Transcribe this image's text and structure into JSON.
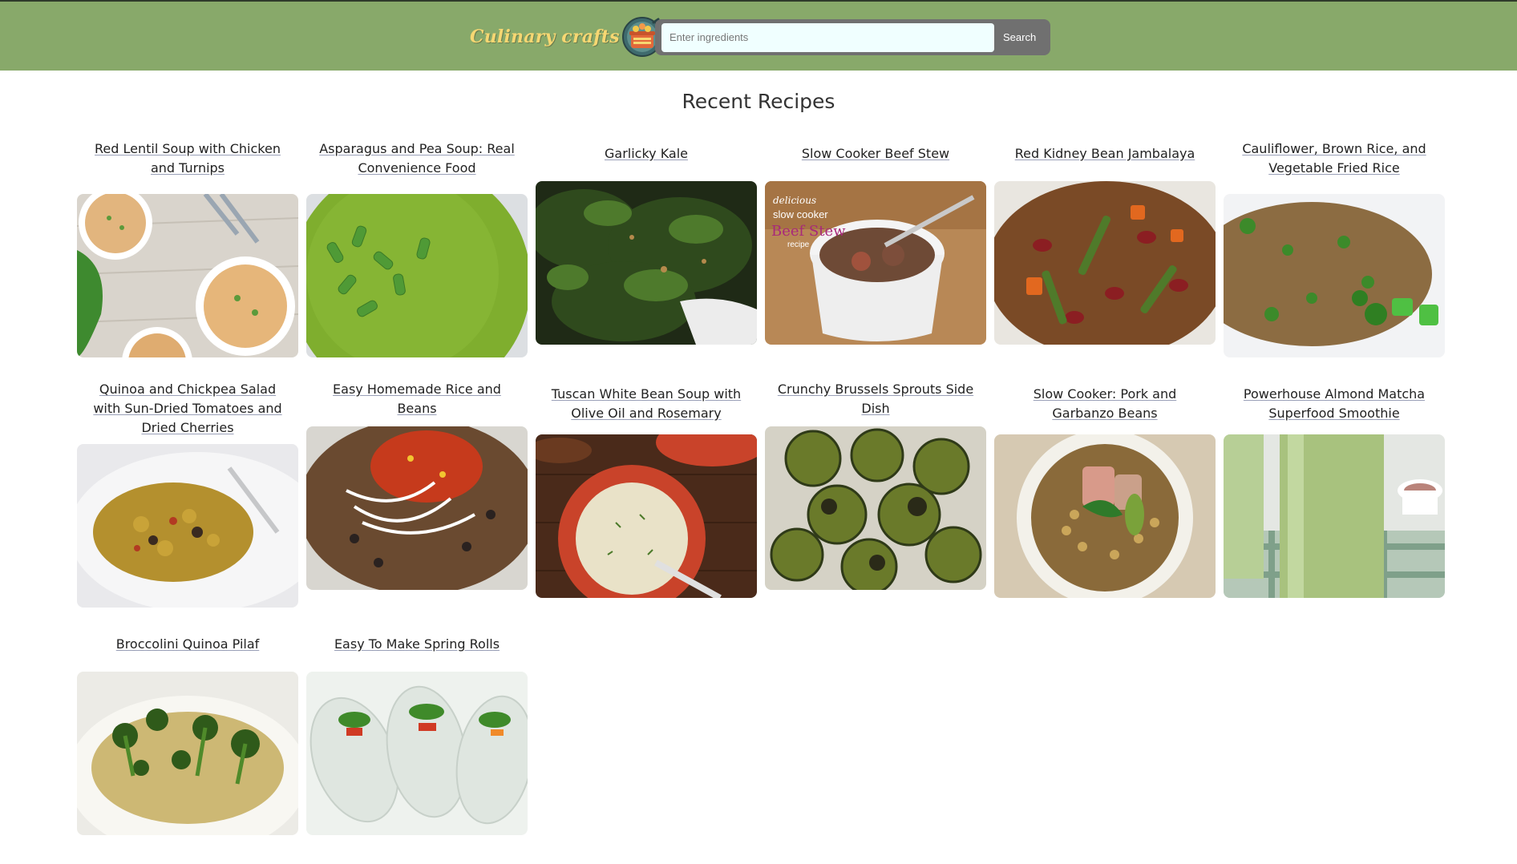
{
  "header": {
    "brand": "Culinary crafts",
    "search_placeholder": "Enter ingredients",
    "search_value": "",
    "search_button": "Search"
  },
  "main": {
    "title": "Recent Recipes",
    "recipes": [
      {
        "title": "Red Lentil Soup with Chicken and Turnips",
        "image": "lentil-soup"
      },
      {
        "title": "Asparagus and Pea Soup: Real Convenience Food",
        "image": "pea-soup"
      },
      {
        "title": "Garlicky Kale",
        "image": "kale"
      },
      {
        "title": "Slow Cooker Beef Stew",
        "image": "beef-stew",
        "image_overlay": [
          "delicious",
          "slow cooker",
          "Beef Stew",
          "recipe"
        ]
      },
      {
        "title": "Red Kidney Bean Jambalaya",
        "image": "jambalaya"
      },
      {
        "title": "Cauliflower, Brown Rice, and Vegetable Fried Rice",
        "image": "fried-rice"
      },
      {
        "title": "Quinoa and Chickpea Salad with Sun-Dried Tomatoes and Dried Cherries",
        "image": "quinoa-salad"
      },
      {
        "title": "Easy Homemade Rice and Beans",
        "image": "rice-beans"
      },
      {
        "title": "Tuscan White Bean Soup with Olive Oil and Rosemary",
        "image": "white-bean-soup"
      },
      {
        "title": "Crunchy Brussels Sprouts Side Dish",
        "image": "brussels-sprouts"
      },
      {
        "title": "Slow Cooker: Pork and Garbanzo Beans",
        "image": "pork-garbanzo"
      },
      {
        "title": "Powerhouse Almond Matcha Superfood Smoothie",
        "image": "matcha-smoothie"
      },
      {
        "title": "Broccolini Quinoa Pilaf",
        "image": "broccolini-pilaf"
      },
      {
        "title": "Easy To Make Spring Rolls",
        "image": "spring-rolls"
      }
    ]
  },
  "colors": {
    "header_bg": "#88a96a",
    "search_bar_bg": "#707070",
    "input_bg": "#f0ffff",
    "brand_text": "#f6d772"
  }
}
